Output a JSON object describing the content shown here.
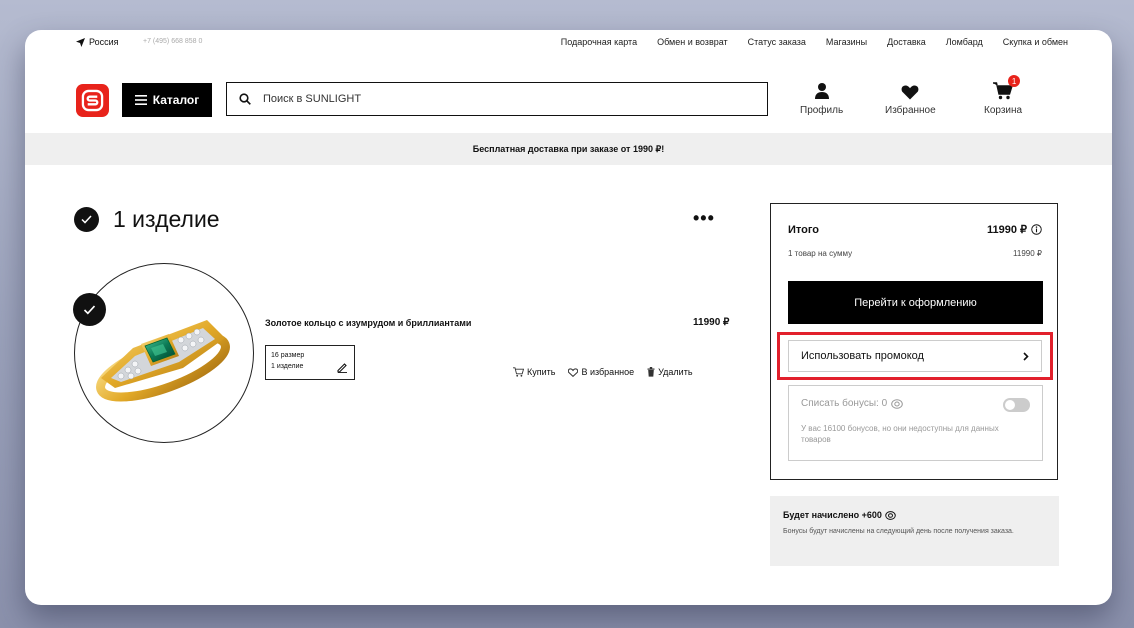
{
  "topbar": {
    "location": "Россия",
    "phone": "+7 (495) 668 858 0",
    "links": [
      "Подарочная карта",
      "Обмен и возврат",
      "Статус заказа",
      "Магазины",
      "Доставка",
      "Ломбард",
      "Скупка и обмен"
    ]
  },
  "header": {
    "catalog_label": "Каталог",
    "search_placeholder": "Поиск в SUNLIGHT",
    "profile_label": "Профиль",
    "favorites_label": "Избранное",
    "cart_label": "Корзина",
    "cart_count": "1"
  },
  "banner": {
    "text": "Бесплатная доставка при заказе от 1990 ₽!"
  },
  "cart": {
    "title": "1 изделие",
    "item": {
      "name": "Золотое кольцо с изумрудом и бриллиантами",
      "price": "11990 ₽",
      "size": "16 размер",
      "quantity": "1 изделие",
      "actions": {
        "buy": "Купить",
        "favorite": "В избранное",
        "remove": "Удалить"
      }
    }
  },
  "summary": {
    "title": "Итого",
    "total": "11990 ₽",
    "row_label": "1 товар на сумму",
    "row_value": "11990 ₽",
    "checkout_label": "Перейти к оформлению",
    "promo_label": "Использовать промокод",
    "bonus_label": "Списать бонусы: 0",
    "bonus_note": "У вас 16100 бонусов, но они недоступны для данных товаров"
  },
  "accrual": {
    "title": "Будет начислено +600",
    "note": "Бонусы будут начислены на следующий день после получения заказа."
  },
  "colors": {
    "brand": "#e8231b",
    "highlight": "#e2202c"
  }
}
